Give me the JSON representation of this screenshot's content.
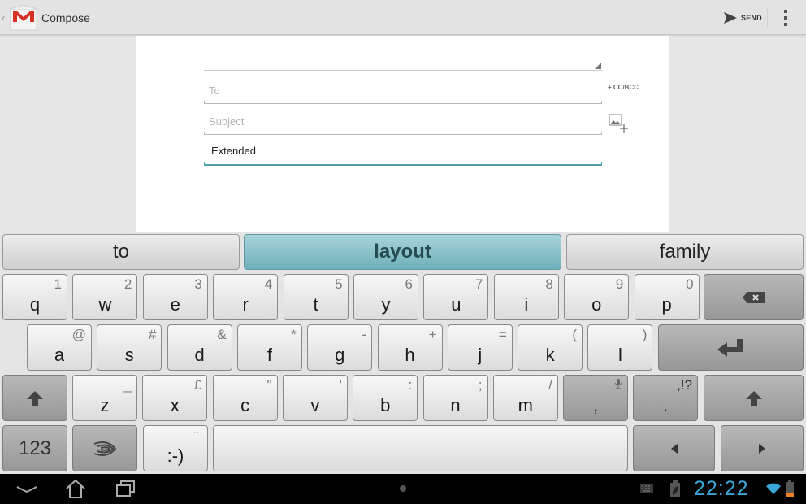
{
  "action_bar": {
    "title": "Compose",
    "app_icon": "gmail-icon",
    "send_label": "SEND",
    "colors": {
      "gmail_red": "#d93025",
      "accent": "#4aa0b0"
    }
  },
  "compose": {
    "to_placeholder": "To",
    "cc_bcc_label": "+ CC/BCC",
    "subject_placeholder": "Subject",
    "body_value": "Extended"
  },
  "keyboard": {
    "suggestions": [
      {
        "label": "to",
        "active": false
      },
      {
        "label": "layout",
        "active": true
      },
      {
        "label": "family",
        "active": false
      }
    ],
    "rows": [
      [
        {
          "main": "q",
          "alt": "1"
        },
        {
          "main": "w",
          "alt": "2"
        },
        {
          "main": "e",
          "alt": "3"
        },
        {
          "main": "r",
          "alt": "4"
        },
        {
          "main": "t",
          "alt": "5"
        },
        {
          "main": "y",
          "alt": "6"
        },
        {
          "main": "u",
          "alt": "7"
        },
        {
          "main": "i",
          "alt": "8"
        },
        {
          "main": "o",
          "alt": "9"
        },
        {
          "main": "p",
          "alt": "0"
        }
      ],
      [
        {
          "main": "a",
          "alt": "@"
        },
        {
          "main": "s",
          "alt": "#"
        },
        {
          "main": "d",
          "alt": "&"
        },
        {
          "main": "f",
          "alt": "*"
        },
        {
          "main": "g",
          "alt": "-"
        },
        {
          "main": "h",
          "alt": "+"
        },
        {
          "main": "j",
          "alt": "="
        },
        {
          "main": "k",
          "alt": "("
        },
        {
          "main": "l",
          "alt": ")"
        }
      ],
      [
        {
          "main": "z",
          "alt": "_"
        },
        {
          "main": "x",
          "alt": "£"
        },
        {
          "main": "c",
          "alt": "\""
        },
        {
          "main": "v",
          "alt": "'"
        },
        {
          "main": "b",
          "alt": ":"
        },
        {
          "main": "n",
          "alt": ";"
        },
        {
          "main": "m",
          "alt": "/"
        }
      ]
    ],
    "comma_key": {
      "main": ",",
      "alt_icon": "microphone-icon"
    },
    "period_key": {
      "main": ".",
      "alt": ",!?"
    },
    "num_key_label": "123",
    "emoji_key": {
      "main": ":-)",
      "alt": "···"
    }
  },
  "system_bar": {
    "clock": "22:22",
    "battery_color": "#f08020",
    "wifi_color": "#3aa7d9"
  }
}
